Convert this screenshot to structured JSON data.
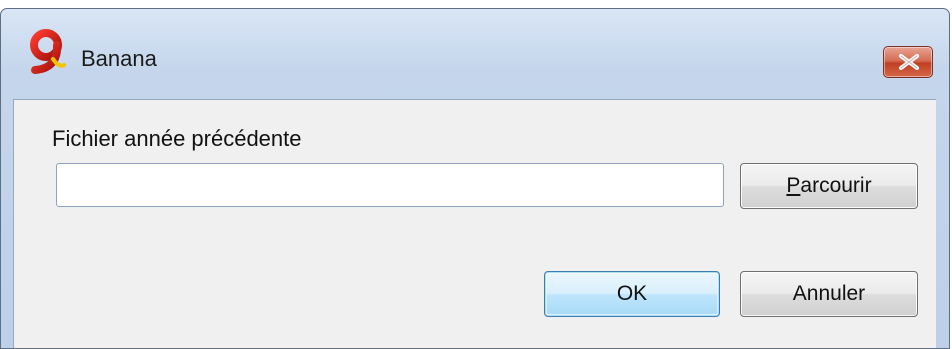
{
  "window": {
    "title": "Banana"
  },
  "form": {
    "label": "Fichier année précédente",
    "file_value": "",
    "browse_label_accel": "P",
    "browse_label_rest": "arcourir"
  },
  "buttons": {
    "ok_label": "OK",
    "cancel_label": "Annuler"
  },
  "icons": {
    "app": "banana-9-logo-icon",
    "close": "close-x-icon"
  },
  "colors": {
    "close_button": "#c13f22",
    "titlebar": "#c5d6ec",
    "client_bg": "#f0f0f0",
    "default_button_border": "#3c7fb1"
  }
}
